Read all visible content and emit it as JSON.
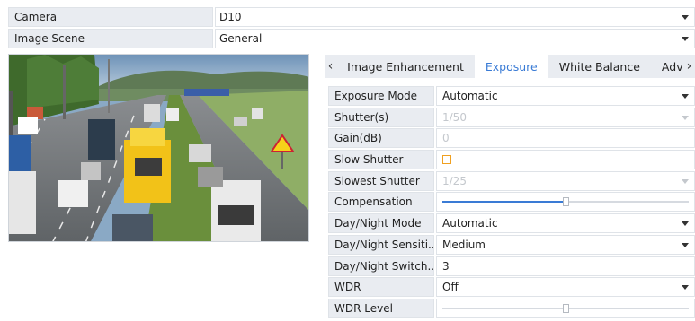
{
  "camera": {
    "label": "Camera",
    "value": "D10"
  },
  "image_scene": {
    "label": "Image Scene",
    "value": "General"
  },
  "tabs": {
    "prev_icon": "chevron-left-icon",
    "next_icon": "chevron-right-icon",
    "items": [
      {
        "label": "Image Enhancement",
        "active": false
      },
      {
        "label": "Exposure",
        "active": true
      },
      {
        "label": "White Balance",
        "active": false
      },
      {
        "label": "Adv",
        "active": false
      }
    ]
  },
  "exposure": {
    "exposure_mode": {
      "label": "Exposure Mode",
      "value": "Automatic"
    },
    "shutter": {
      "label": "Shutter(s)",
      "value": "1/50"
    },
    "gain": {
      "label": "Gain(dB)",
      "value": "0"
    },
    "slow_shutter": {
      "label": "Slow Shutter",
      "checked": false
    },
    "slowest_shutter": {
      "label": "Slowest Shutter",
      "value": "1/25"
    },
    "compensation": {
      "label": "Compensation",
      "level": 0.5
    },
    "day_night_mode": {
      "label": "Day/Night Mode",
      "value": "Automatic"
    },
    "day_night_sensitivity": {
      "label": "Day/Night Sensiti...",
      "value": "Medium"
    },
    "day_night_switch": {
      "label": "Day/Night Switch...",
      "value": "3"
    },
    "wdr": {
      "label": "WDR",
      "value": "Off"
    },
    "wdr_level": {
      "label": "WDR Level",
      "level": 0.5
    }
  },
  "colors": {
    "accent": "#3a7bd5",
    "label_bg": "#e9ecf1",
    "checkbox": "#f0a020",
    "disabled_text": "#c4c8cd"
  }
}
